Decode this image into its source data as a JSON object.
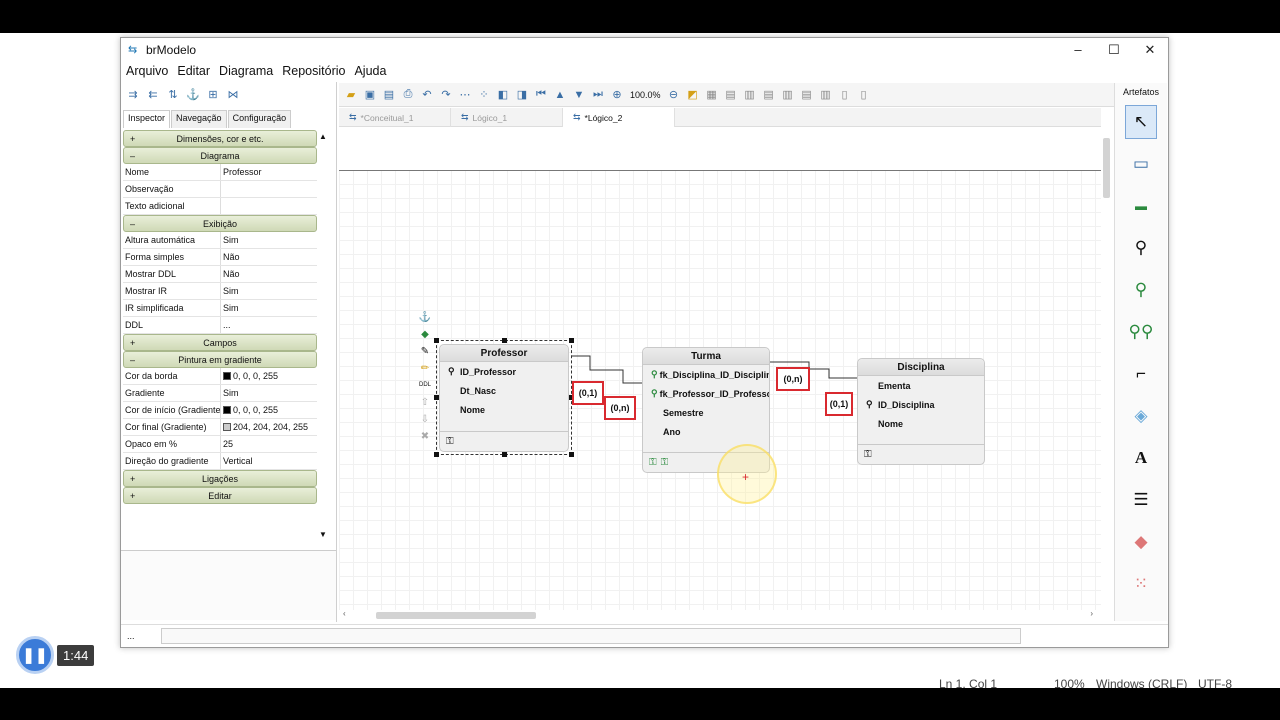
{
  "window": {
    "title": "brModelo",
    "min": "–",
    "max": "☐",
    "close": "✕"
  },
  "menu": [
    "Arquivo",
    "Editar",
    "Diagrama",
    "Repositório",
    "Ajuda"
  ],
  "left_tabs": [
    "Inspector",
    "Navegação",
    "Configuração"
  ],
  "inspector": [
    {
      "section": "Dimensões, cor e etc.",
      "sign": "+"
    },
    {
      "section": "Diagrama",
      "sign": "–"
    },
    {
      "k": "Nome",
      "v": "Professor"
    },
    {
      "k": "Observação",
      "v": ""
    },
    {
      "k": "Texto adicional",
      "v": ""
    },
    {
      "section": "Exibição",
      "sign": "–"
    },
    {
      "k": "Altura automática",
      "v": "Sim"
    },
    {
      "k": "Forma simples",
      "v": "Não"
    },
    {
      "k": "Mostrar DDL",
      "v": "Não"
    },
    {
      "k": "Mostrar IR",
      "v": "Sim"
    },
    {
      "k": "IR simplificada",
      "v": "Sim"
    },
    {
      "k": "DDL",
      "v": "..."
    },
    {
      "section": "Campos",
      "sign": "+"
    },
    {
      "section": "Pintura em gradiente",
      "sign": "–"
    },
    {
      "k": "Cor da borda",
      "v": "0, 0, 0, 255",
      "swatch": "#000000"
    },
    {
      "k": "Gradiente",
      "v": "Sim"
    },
    {
      "k": "Cor de início (Gradiente)",
      "v": "0, 0, 0, 255",
      "swatch": "#000000"
    },
    {
      "k": "Cor final (Gradiente)",
      "v": "204, 204, 204, 255",
      "swatch": "#cccccc"
    },
    {
      "k": "Opaco em %",
      "v": "25"
    },
    {
      "k": "Direção do gradiente",
      "v": "Vertical"
    },
    {
      "section": "Ligações",
      "sign": "+"
    },
    {
      "section": "Editar",
      "sign": "+"
    }
  ],
  "canvas_toolbar": {
    "zoom": "100.0%"
  },
  "doc_tabs": [
    {
      "label": "*Conceitual_1",
      "active": false
    },
    {
      "label": "Lógico_1",
      "active": false
    },
    {
      "label": "*Lógico_2",
      "active": true
    }
  ],
  "right_panel": {
    "header": "Artefatos"
  },
  "entities": {
    "professor": {
      "name": "Professor",
      "attrs": [
        {
          "name": "ID_Professor",
          "key": "pk"
        },
        {
          "name": "Dt_Nasc",
          "key": ""
        },
        {
          "name": "Nome",
          "key": ""
        }
      ]
    },
    "turma": {
      "name": "Turma",
      "attrs": [
        {
          "name": "fk_Disciplina_ID_Disciplina",
          "key": "fk"
        },
        {
          "name": "fk_Professor_ID_Professor",
          "key": "fk"
        },
        {
          "name": "Semestre",
          "key": ""
        },
        {
          "name": "Ano",
          "key": ""
        }
      ]
    },
    "disciplina": {
      "name": "Disciplina",
      "attrs": [
        {
          "name": "Ementa",
          "key": ""
        },
        {
          "name": "ID_Disciplina",
          "key": "pk"
        },
        {
          "name": "Nome",
          "key": ""
        }
      ]
    }
  },
  "cardinalities": {
    "c1": "(0,1)",
    "c2": "(0,n)",
    "c3": "(0,n)",
    "c4": "(0,1)"
  },
  "side_tools": {
    "ddl": "DDL"
  },
  "statusbar": {
    "dots": "..."
  },
  "video": {
    "time": "1:44"
  },
  "outer_status": {
    "pos": "Ln 1, Col 1",
    "zoom": "100%",
    "eol": "Windows (CRLF)",
    "enc": "UTF-8"
  },
  "colors": {
    "accent_red": "#d9292f",
    "fk_green": "#2b8a3e",
    "section_green": "#cfd9b6"
  }
}
